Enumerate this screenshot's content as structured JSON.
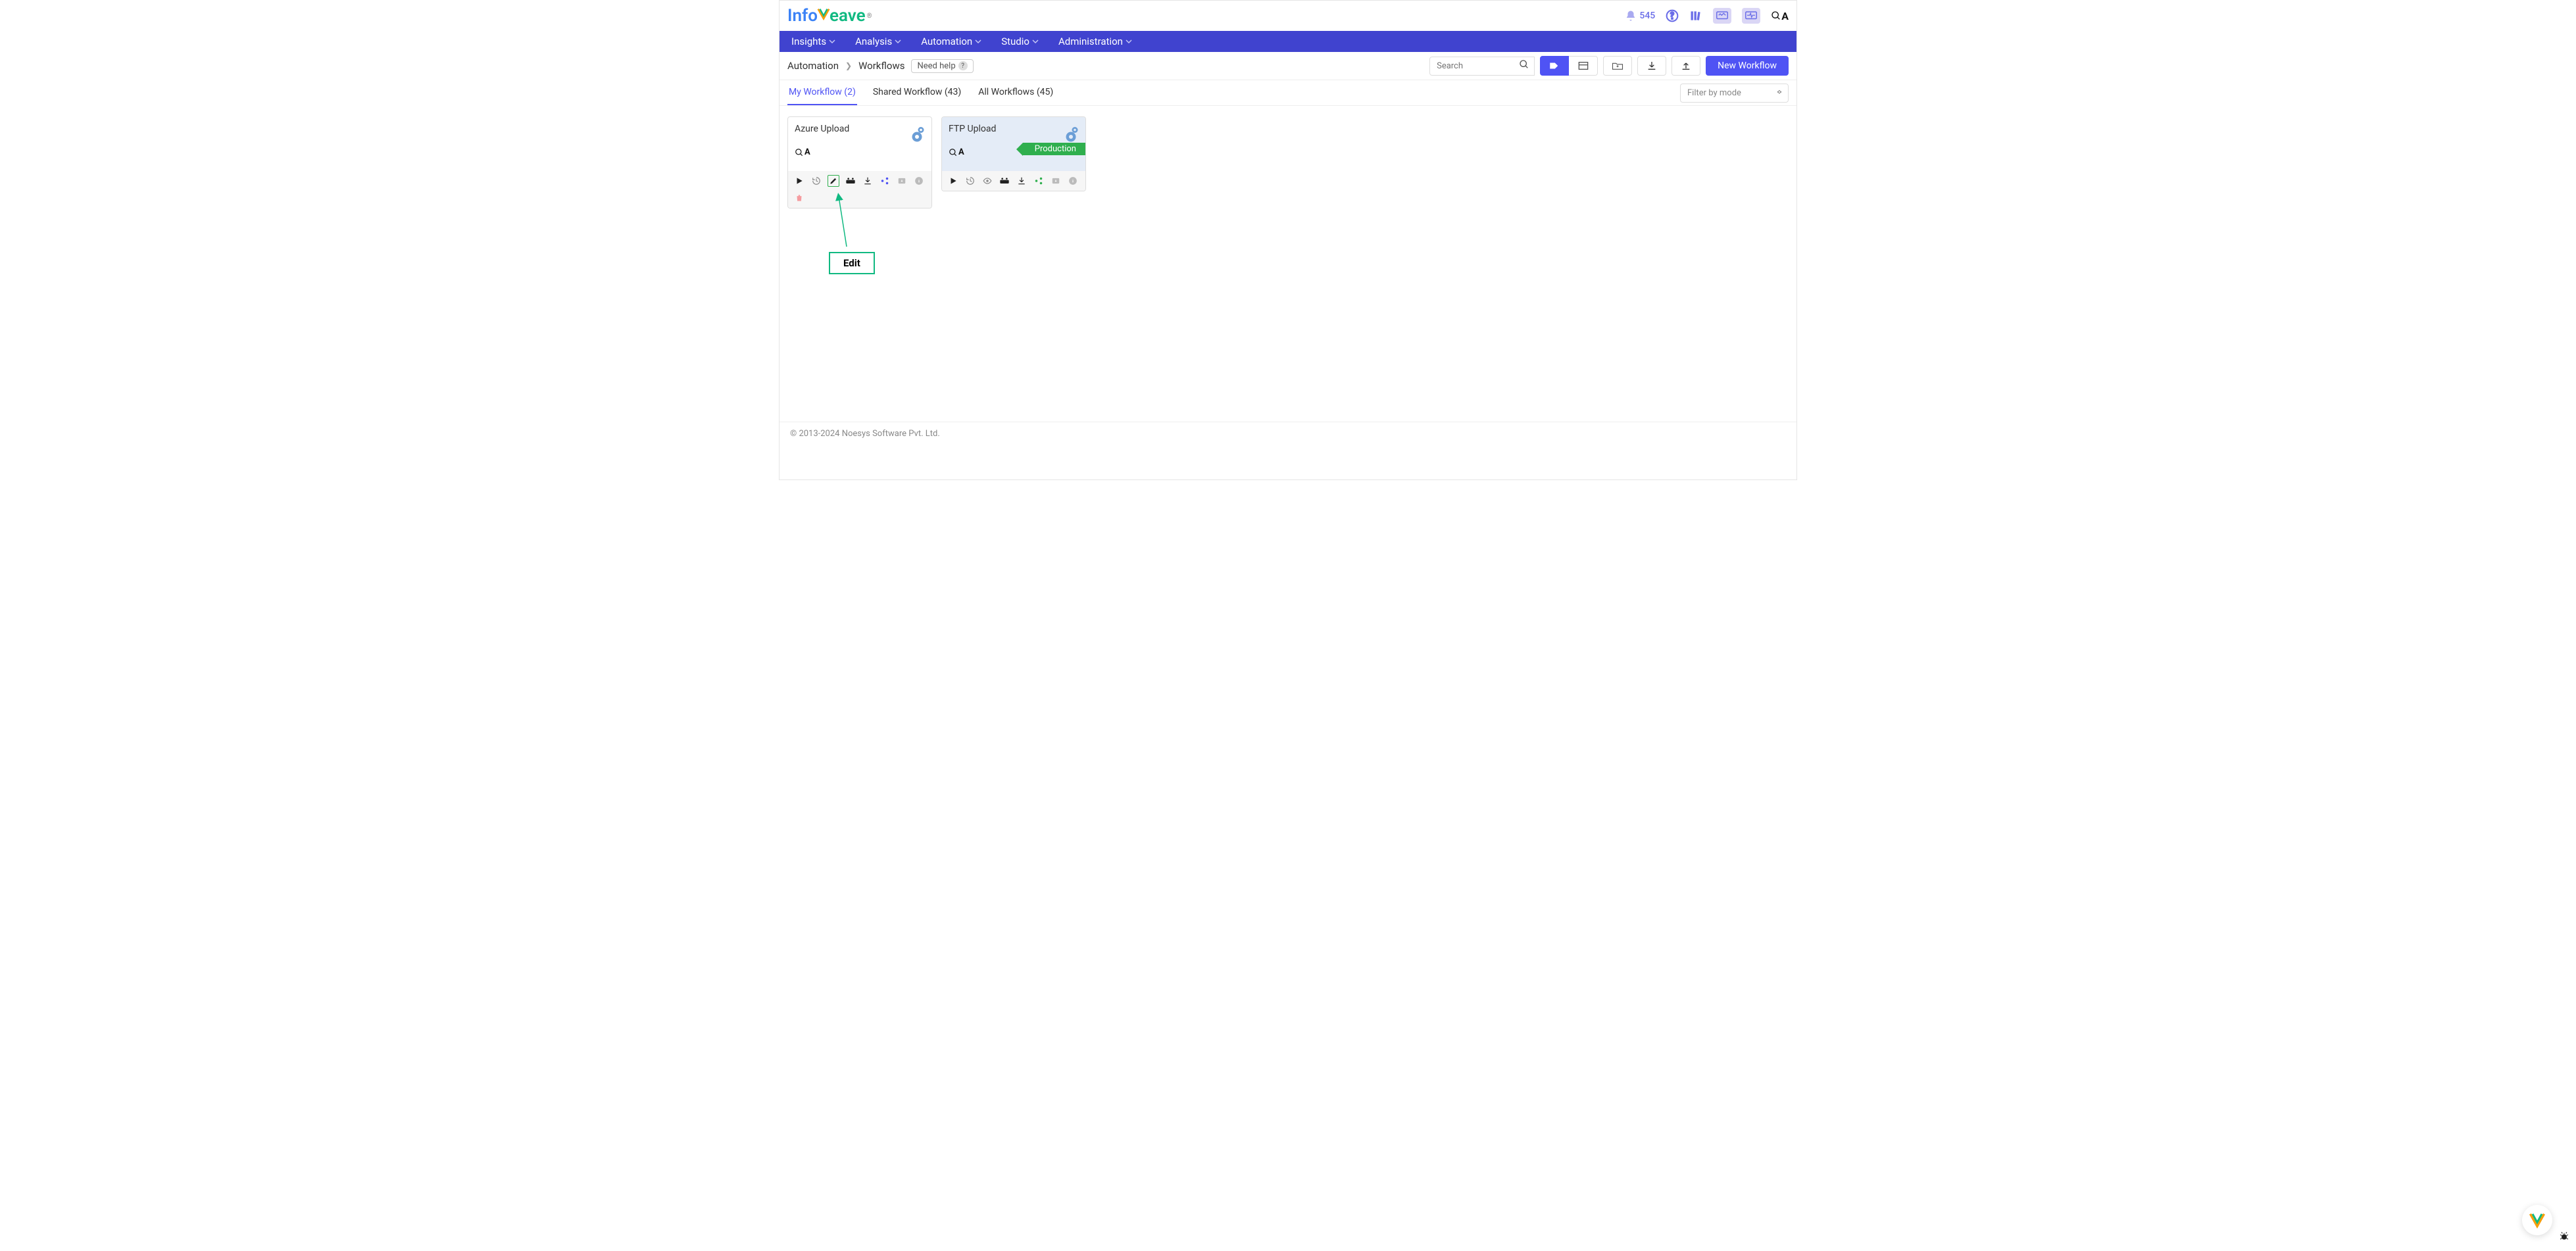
{
  "header": {
    "logo_info": "Info",
    "logo_eave": "eave",
    "notif_count": "545"
  },
  "nav": {
    "insights": "Insights",
    "analysis": "Analysis",
    "automation": "Automation",
    "studio": "Studio",
    "administration": "Administration"
  },
  "breadcrumb": {
    "automation": "Automation",
    "workflows": "Workflows",
    "need_help": "Need help",
    "search_placeholder": "Search",
    "new_workflow": "New Workflow"
  },
  "tabs": {
    "my": "My Workflow (2)",
    "shared": "Shared Workflow (43)",
    "all": "All Workflows (45)",
    "filter_placeholder": "Filter by mode"
  },
  "cards": [
    {
      "title": "Azure Upload",
      "qa": "A",
      "environment": null
    },
    {
      "title": "FTP Upload",
      "qa": "A",
      "environment": "Production"
    }
  ],
  "annotation": {
    "label": "Edit"
  },
  "footer": {
    "copyright": "© 2013-2024 Noesys Software Pvt. Ltd."
  }
}
